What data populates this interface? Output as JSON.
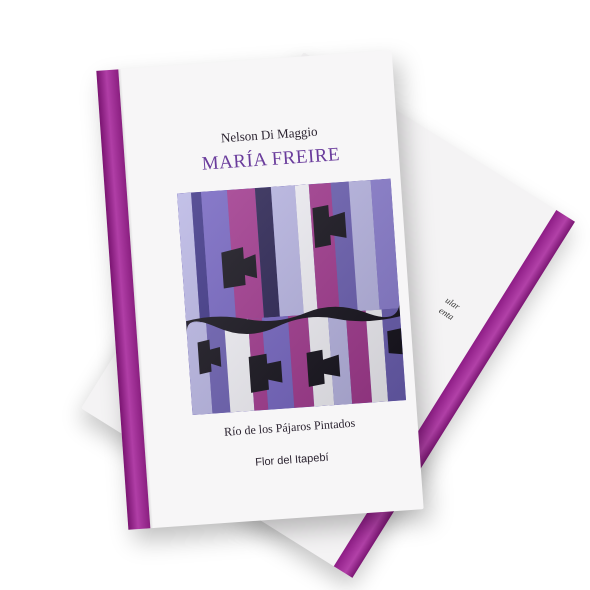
{
  "book": {
    "author": "Nelson Di Maggio",
    "title": "MARÍA FREIRE",
    "subtitle": "Río de los Pájaros Pintados",
    "publisher": "Flor del Itapebí"
  },
  "back_book": {
    "visible_fragment": "ular\nenta"
  },
  "colors": {
    "spine": "#a0309a",
    "art_violet": "#6b5fb2",
    "art_magenta": "#a2398f",
    "art_lavender": "#b9b6e4",
    "art_white": "#f3f2f8",
    "art_black": "#15121c",
    "title": "#6a3c9c"
  },
  "icons": [
    "abstract-painting"
  ]
}
